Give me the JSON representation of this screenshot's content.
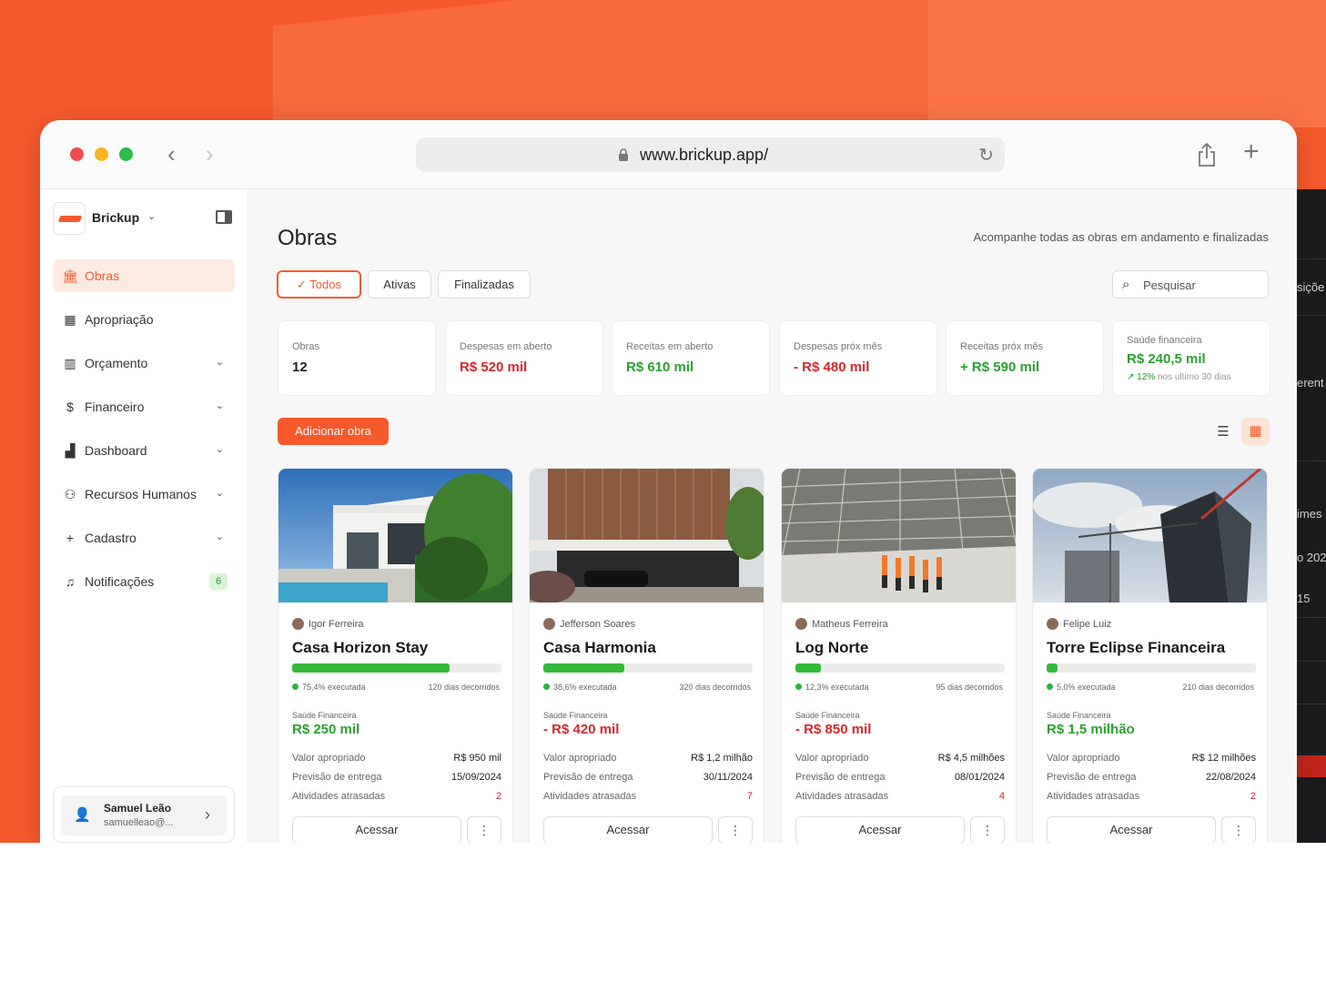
{
  "browser": {
    "url": "www.brickup.app/"
  },
  "sidebar": {
    "brand": "Brickup",
    "items": [
      {
        "label": "Obras",
        "icon": "building-icon",
        "glyph": "🏛"
      },
      {
        "label": "Apropriação",
        "icon": "grid-icon",
        "glyph": "▦"
      },
      {
        "label": "Orçamento",
        "icon": "book-icon",
        "glyph": "▥"
      },
      {
        "label": "Financeiro",
        "icon": "dollar-icon",
        "glyph": "$"
      },
      {
        "label": "Dashboard",
        "icon": "chart-icon",
        "glyph": "▟"
      },
      {
        "label": "Recursos Humanos",
        "icon": "users-icon",
        "glyph": "⚇"
      },
      {
        "label": "Cadastro",
        "icon": "plus-icon",
        "glyph": "+"
      },
      {
        "label": "Notificações",
        "icon": "bell-icon",
        "glyph": "♫",
        "badge": "6"
      }
    ],
    "user": {
      "name": "Samuel Leão",
      "email": "samuelleao@..."
    }
  },
  "main": {
    "title": "Obras",
    "subtitle": "Acompanhe todas as obras em andamento e finalizadas",
    "filters": [
      "Todos",
      "Ativas",
      "Finalizadas"
    ],
    "search_placeholder": "Pesquisar",
    "add_button": "Adicionar obra",
    "stats": [
      {
        "label": "Obras",
        "value": "12"
      },
      {
        "label": "Despesas em aberto",
        "value": "R$ 520 mil"
      },
      {
        "label": "Receitas em aberto",
        "value": "R$ 610 mil"
      },
      {
        "label": "Despesas próx mês",
        "value": "- R$ 480 mil"
      },
      {
        "label": "Receitas próx mês",
        "value": "+ R$ 590 mil"
      },
      {
        "label": "Saúde financeira",
        "value": "R$ 240,5 mil",
        "trend_arrow": "↗",
        "trend_pct": "12%",
        "trend_text": "nos ultimo 30 dias"
      }
    ],
    "project_labels": {
      "health_label": "Saúde Financeira",
      "valor_label": "Valor apropriado",
      "previsao_label": "Previsão de entrega",
      "atrasadas_label": "Atividades atrasadas",
      "access_label": "Acessar",
      "more_glyph": "⋮"
    },
    "projects": [
      {
        "manager": "Igor Ferreira",
        "name": "Casa Horizon Stay",
        "progress": 75.4,
        "executed": "75,4% executada",
        "days": "120 dias decorridos",
        "health": "R$ 250 mil",
        "valor": "R$ 950 mil",
        "previsao": "15/09/2024",
        "atrasadas": "2"
      },
      {
        "manager": "Jefferson Soares",
        "name": "Casa Harmonia",
        "progress": 38.6,
        "executed": "38,6% executada",
        "days": "320 dias decorridos",
        "health": "- R$ 420 mil",
        "valor": "R$ 1,2 milhão",
        "previsao": "30/11/2024",
        "atrasadas": "7"
      },
      {
        "manager": "Matheus Ferreira",
        "name": "Log Norte",
        "progress": 12.3,
        "executed": "12,3% executada",
        "days": "95 dias decorridos",
        "health": "- R$ 850 mil",
        "valor": "R$ 4,5 milhões",
        "previsao": "08/01/2024",
        "atrasadas": "4"
      },
      {
        "manager": "Felipe Luiz",
        "name": "Torre Eclipse Financeira",
        "progress": 5.0,
        "executed": "5,0% executada",
        "days": "210 dias decorridos",
        "health": "R$ 1,5 milhão",
        "valor": "R$ 12 milhões",
        "previsao": "22/08/2024",
        "atrasadas": "2"
      }
    ]
  },
  "background_strip": {
    "texts": [
      "siçõe",
      "erent",
      "imes",
      "o 202",
      "15"
    ]
  },
  "colors": {
    "accent": "#f55a2c",
    "positive": "#2aa12f",
    "negative": "#d8262c",
    "progress": "#35b93a"
  }
}
